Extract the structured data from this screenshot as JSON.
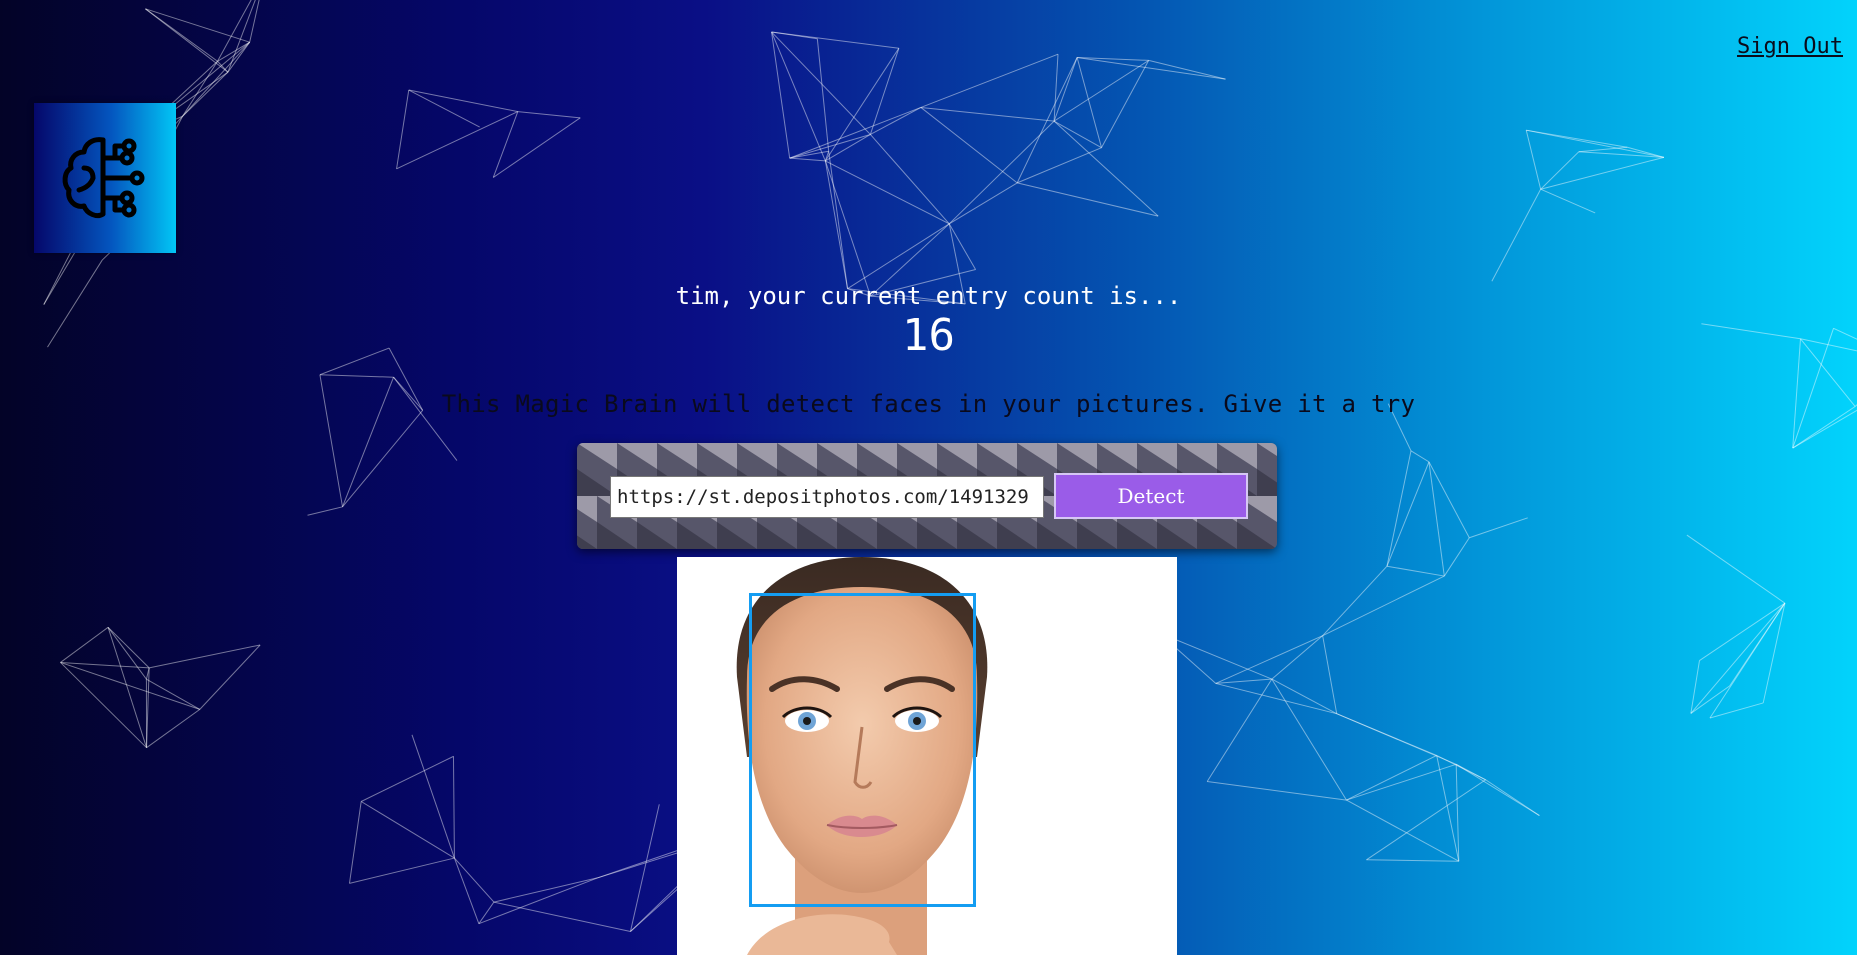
{
  "header": {
    "signout_label": "Sign Out"
  },
  "logo": {
    "icon": "brain-circuit-icon"
  },
  "rank": {
    "user": "tim",
    "greeting": "tim, your current entry count is...",
    "count": "16"
  },
  "intro": {
    "text": "This Magic Brain will detect faces in your pictures. Give it a try"
  },
  "form": {
    "url_value": "https://st.depositphotos.com/1491329",
    "detect_label": "Detect"
  },
  "result": {
    "image_alt": "face photo",
    "face_count": 1
  },
  "colors": {
    "accent": "#9a5ce8",
    "face_box": "#149df2"
  }
}
